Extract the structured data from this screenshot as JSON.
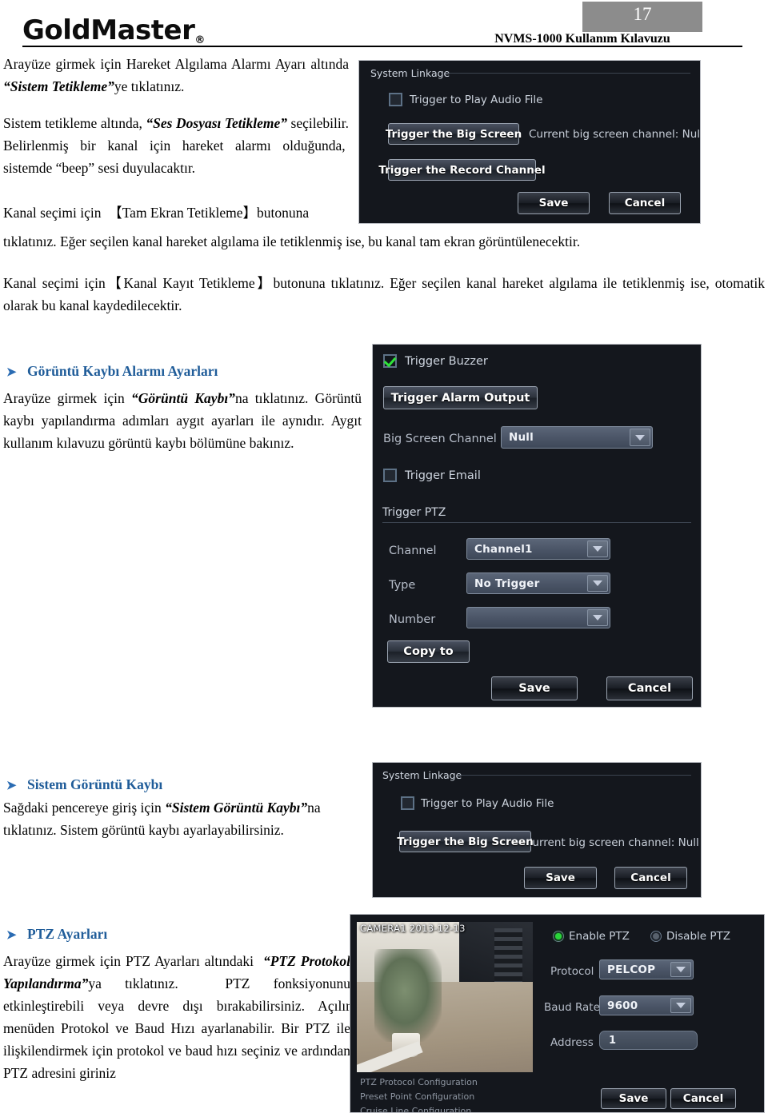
{
  "header": {
    "logo_text": "GoldMaster",
    "logo_mark": "®",
    "page_number": "17",
    "manual_title": "NVMS-1000 Kullanım Kılavuzu"
  },
  "body": {
    "intro_p1": "Arayüze girmek için Hareket Algılama Alarmı Ayarı altında ",
    "intro_p1_em": "“Sistem Tetikleme”",
    "intro_p1_tail": "ye tıklatınız.",
    "intro_p2_head": "Sistem tetikleme altında, ",
    "intro_p2_em": "“Ses Dosyası Tetikleme”",
    "intro_p2_tail": " seçilebilir. Belirlenmiş bir kanal için hareket alarmı olduğunda,  sistemde “beep” sesi duyulacaktır.",
    "intro_p3": "Kanal seçimi için  【Tam Ekran Tetikleme】 butonuna tıklatınız. Eğer seçilen kanal hareket algılama ile tetiklenmiş ise, bu kanal tam ekran görüntülenecektir.",
    "para_record": "Kanal seçimi için【Kanal Kayıt Tetikleme】butonuna tıklatınız. Eğer seçilen kanal hareket algılama ile tetiklenmiş ise, otomatik olarak bu kanal kaydedilecektir."
  },
  "sections": [
    {
      "heading": "Görüntü Kaybı Alarmı Ayarları",
      "text_head": "Arayüze girmek için ",
      "text_em": "“Görüntü Kaybı”",
      "text_tail": "na tıklatınız. Görüntü kaybı yapılandırma adımları aygıt ayarları ile aynıdır. Aygıt kullanım kılavuzu görüntü kaybı bölümüne bakınız."
    },
    {
      "heading": "Sistem Görüntü Kaybı",
      "text_head": "Sağdaki pencereye giriş için ",
      "text_em": "“Sistem Görüntü Kaybı”",
      "text_tail": "na tıklatınız. Sistem görüntü kaybı ayarlayabilirsiniz."
    },
    {
      "heading": "PTZ Ayarları",
      "text_head": "Arayüze girmek için PTZ Ayarları altındaki  ",
      "text_em": "“PTZ Protokol Yapılandırma”",
      "text_tail": "ya tıklatınız.  PTZ fonksiyonunu etkinleştirebili veya devre dışı bırakabilirsiniz. Açılır menüden Protokol ve Baud Hızı ayarlanabilir. Bir PTZ ile ilişkilendirmek için protokol ve baud hızı seçiniz ve ardından PTZ adresini giriniz"
    }
  ],
  "panel_linkage_top": {
    "group_title": "System Linkage",
    "audio_checkbox_label": "Trigger to Play Audio File",
    "big_screen_button": "Trigger the Big Screen",
    "big_screen_status": "Current big screen channel: Null",
    "record_channel_button": "Trigger the Record Channel",
    "save_button": "Save",
    "cancel_button": "Cancel"
  },
  "panel_video_loss": {
    "buzzer_label": "Trigger Buzzer",
    "alarm_output_button": "Trigger Alarm Output",
    "big_screen_channel_label": "Big Screen Channel",
    "big_screen_channel_value": "Null",
    "email_label": "Trigger Email",
    "trigger_ptz_group": "Trigger PTZ",
    "channel_label": "Channel",
    "channel_value": "Channel1",
    "type_label": "Type",
    "type_value": "No Trigger",
    "number_label": "Number",
    "number_value": "",
    "copy_to_button": "Copy to",
    "save_button": "Save",
    "cancel_button": "Cancel"
  },
  "panel_linkage_bottom": {
    "group_title": "System Linkage",
    "audio_checkbox_label": "Trigger to Play Audio File",
    "big_screen_button": "Trigger the Big Screen",
    "big_screen_status": "Current big screen channel: Null",
    "save_button": "Save",
    "cancel_button": "Cancel"
  },
  "panel_ptz": {
    "camera_label": "CAMERA1 2013-12-13",
    "enable_label": "Enable PTZ",
    "disable_label": "Disable PTZ",
    "protocol_label": "Protocol",
    "protocol_value": "PELCOP",
    "baud_label": "Baud Rate",
    "baud_value": "9600",
    "address_label": "Address",
    "address_value": "1",
    "save_button": "Save",
    "cancel_button": "Cancel",
    "nav_links": [
      "PTZ Protocol Configuration",
      "Preset Point Configuration",
      "Cruise Line Configuration"
    ]
  },
  "colors": {
    "heading": "#1f5c99",
    "panel_bg": "#14171d",
    "page_badge": "#8c8c8c",
    "checked_green": "#2fe33a"
  }
}
